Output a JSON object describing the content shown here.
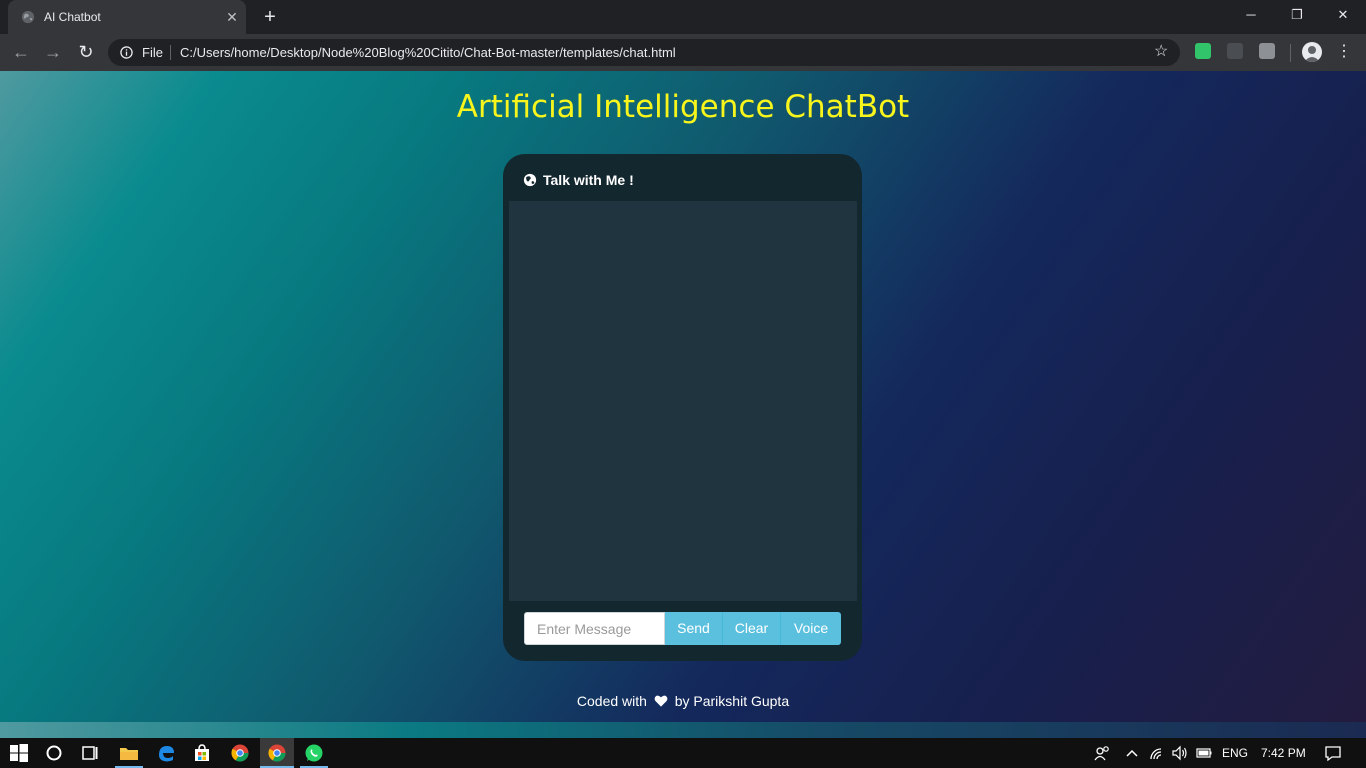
{
  "browser": {
    "tab_title": "AI Chatbot",
    "tab_close": "✕",
    "new_tab": "+",
    "window_controls": {
      "minimize": "─",
      "restore": "❐",
      "close": "✕"
    },
    "nav": {
      "back": "←",
      "forward": "→",
      "reload": "↻"
    },
    "url_scheme": "File",
    "url": "C:/Users/home/Desktop/Node%20Blog%20Citito/Chat-Bot-master/templates/chat.html",
    "bookmark_star": "☆",
    "menu": "⋮"
  },
  "page": {
    "title": "Artificial Intelligence ChatBot",
    "chat": {
      "header_label": "Talk with Me !",
      "input_placeholder": "Enter Message",
      "send_label": "Send",
      "clear_label": "Clear",
      "voice_label": "Voice"
    },
    "footer": {
      "prefix": "Coded with",
      "suffix": "by Parikshit Gupta"
    }
  },
  "taskbar": {
    "language": "ENG",
    "time": "7:42 PM"
  },
  "colors": {
    "title_yellow": "#f7f51c",
    "button_blue": "#5bc0de",
    "card_bg": "#13272f",
    "chat_area_bg": "#1f343e"
  }
}
